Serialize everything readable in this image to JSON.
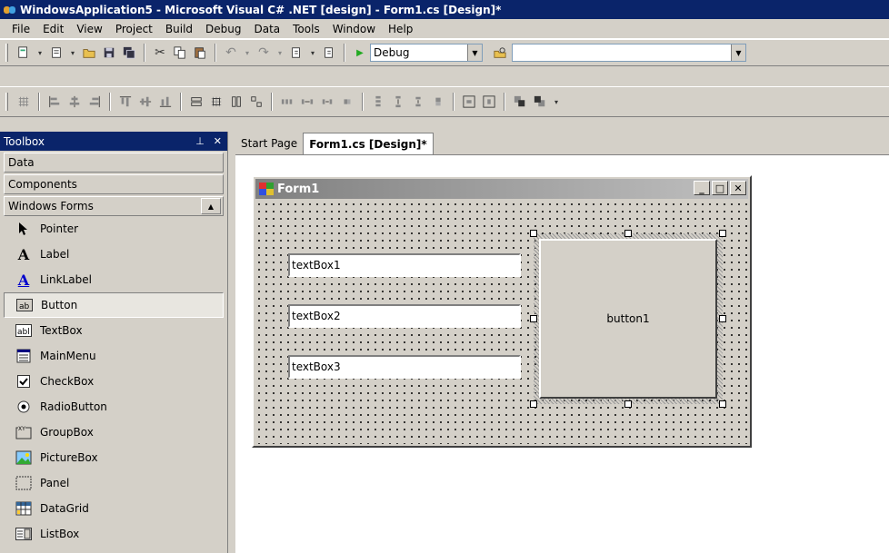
{
  "window": {
    "title": "WindowsApplication5 - Microsoft Visual C# .NET [design] - Form1.cs [Design]*"
  },
  "menu": [
    "File",
    "Edit",
    "View",
    "Project",
    "Build",
    "Debug",
    "Data",
    "Tools",
    "Window",
    "Help"
  ],
  "toolbar": {
    "config": "Debug",
    "search": ""
  },
  "toolbox": {
    "title": "Toolbox",
    "pin": "⊥",
    "close": "✕",
    "tabs": [
      "Data",
      "Components",
      "Windows Forms"
    ],
    "items": [
      {
        "label": "Pointer",
        "icon": "pointer-icon"
      },
      {
        "label": "Label",
        "icon": "label-icon"
      },
      {
        "label": "LinkLabel",
        "icon": "linklabel-icon"
      },
      {
        "label": "Button",
        "icon": "button-icon",
        "selected": true
      },
      {
        "label": "TextBox",
        "icon": "textbox-icon"
      },
      {
        "label": "MainMenu",
        "icon": "mainmenu-icon"
      },
      {
        "label": "CheckBox",
        "icon": "checkbox-icon"
      },
      {
        "label": "RadioButton",
        "icon": "radiobutton-icon"
      },
      {
        "label": "GroupBox",
        "icon": "groupbox-icon"
      },
      {
        "label": "PictureBox",
        "icon": "picturebox-icon"
      },
      {
        "label": "Panel",
        "icon": "panel-icon"
      },
      {
        "label": "DataGrid",
        "icon": "datagrid-icon"
      },
      {
        "label": "ListBox",
        "icon": "listbox-icon"
      }
    ]
  },
  "doctabs": [
    "Start Page",
    "Form1.cs [Design]*"
  ],
  "form": {
    "title": "Form1",
    "textboxes": [
      "textBox1",
      "textBox2",
      "textBox3"
    ],
    "button": "button1"
  },
  "colors": {
    "title_bar": "#0a246a",
    "face": "#d4d0c8",
    "form_title_start": "#808080"
  }
}
